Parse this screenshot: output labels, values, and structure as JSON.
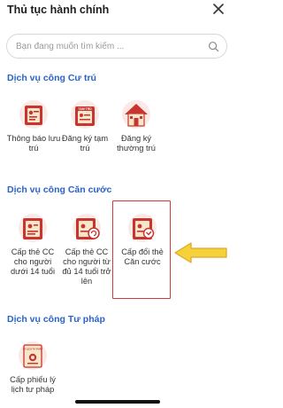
{
  "header": {
    "title": "Thủ tục hành chính",
    "close_icon": "close-icon"
  },
  "search": {
    "placeholder": "Bạn đang muốn tìm kiếm ...",
    "value": "",
    "icon": "search-icon"
  },
  "sections": [
    {
      "title": "Dịch vụ công Cư trú",
      "items": [
        {
          "label": "Thông báo lưu trú",
          "icon": "residence-notice-icon"
        },
        {
          "label": "Đăng ký tạm trú",
          "icon": "temporary-residence-icon"
        },
        {
          "label": "Đăng ký thường trú",
          "icon": "permanent-residence-icon"
        }
      ]
    },
    {
      "title": "Dịch vụ công Căn cước",
      "items": [
        {
          "label": "Cấp thẻ CC cho người dưới 14 tuổi",
          "icon": "id-card-under14-icon"
        },
        {
          "label": "Cấp thẻ CC cho người từ đủ 14 tuổi trở lên",
          "icon": "id-card-over14-icon"
        },
        {
          "label": "Cấp đổi thẻ Căn cước",
          "icon": "id-card-renew-icon"
        }
      ]
    },
    {
      "title": "Dịch vụ công Tư pháp",
      "items": [
        {
          "label": "Cấp phiếu lý lịch tư pháp",
          "icon": "judicial-record-icon"
        }
      ]
    }
  ],
  "icon_badge_text": {
    "temporary": "TẠM TRÚ",
    "judicial": "LÝ LỊCH TƯ PHÁP"
  },
  "colors": {
    "accent": "#2962c8",
    "icon_red": "#c8342f",
    "icon_cream": "#f7e6c9",
    "highlight": "#d23b3b",
    "arrow": "#f6d23a"
  }
}
